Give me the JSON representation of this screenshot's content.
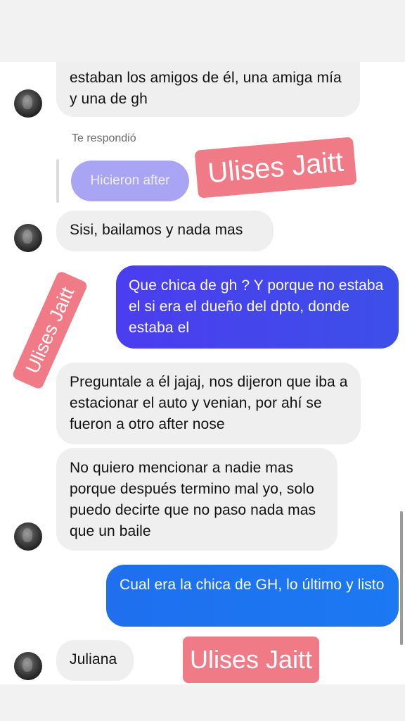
{
  "conversation": {
    "messages": [
      {
        "text": "estaban los amigos de él, una amiga mía y una de gh"
      },
      {
        "text": "Sisi, bailamos y nada mas"
      },
      {
        "text": "Que chica de gh ? Y porque no estaba el si era el dueño del dpto, donde estaba el"
      },
      {
        "text": "Preguntale a él jajaj, nos dijeron que iba a estacionar el auto y venian, por ahí se fueron a otro after nose"
      },
      {
        "text": "No quiero mencionar a nadie mas porque después termino mal yo, solo puedo decirte que no paso nada mas que un baile"
      },
      {
        "text": "Cual era la chica de GH, lo último y listo"
      },
      {
        "text": "Juliana"
      }
    ],
    "reply": {
      "label": "Te respondió",
      "quoted": "Hicieron after"
    }
  },
  "watermark": {
    "text": "Ulises Jaitt",
    "color": "#f07a86"
  },
  "colors": {
    "incoming_bubble": "#efefef",
    "outgoing_purple": "#4b3df0",
    "outgoing_blue": "#1f6fef"
  }
}
